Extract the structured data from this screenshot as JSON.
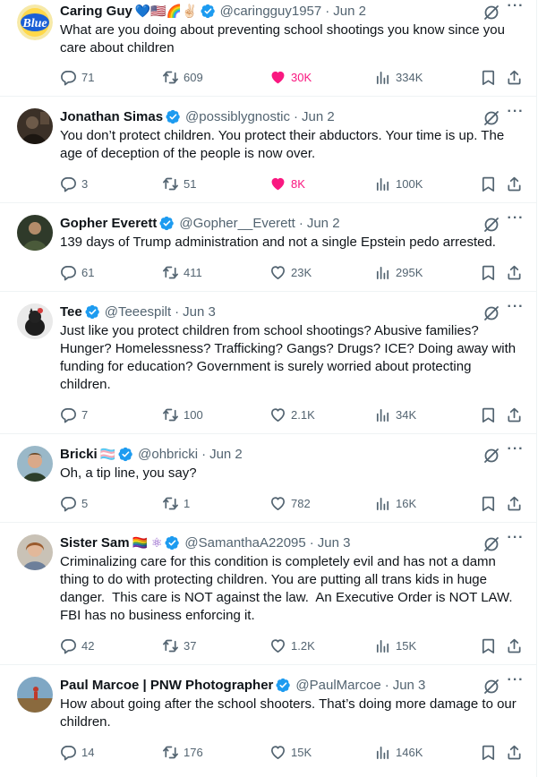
{
  "tweets": [
    {
      "name": "Caring Guy",
      "emoji": "💙🇺🇸🌈✌🏻",
      "handle": "@caringguy1957",
      "date": "Jun 2",
      "text": "What are you doing about preventing school shootings you know since you care about children",
      "replies": "71",
      "reposts": "609",
      "likes": "30K",
      "views": "334K",
      "liked": true
    },
    {
      "name": "Jonathan Simas",
      "emoji": "",
      "handle": "@possiblygnostic",
      "date": "Jun 2",
      "text": "You don’t protect children. You protect their abductors. Your time is up. The age of deception of the people is now over.",
      "replies": "3",
      "reposts": "51",
      "likes": "8K",
      "views": "100K",
      "liked": true
    },
    {
      "name": "Gopher Everett",
      "emoji": "",
      "handle": "@Gopher__Everett",
      "date": "Jun 2",
      "text": "139 days of Trump administration and not a single Epstein pedo arrested.",
      "replies": "61",
      "reposts": "411",
      "likes": "23K",
      "views": "295K",
      "liked": false
    },
    {
      "name": "Tee",
      "emoji": "",
      "handle": "@Teeespilt",
      "date": "Jun 3",
      "text": "Just like you protect children from school shootings? Abusive families? Hunger? Homelessness? Trafficking? Gangs? Drugs? ICE? Doing away with funding for education? Government is surely worried about protecting children.",
      "replies": "7",
      "reposts": "100",
      "likes": "2.1K",
      "views": "34K",
      "liked": false
    },
    {
      "name": "Bricki",
      "emoji": "🏳️‍⚧️",
      "handle": "@ohbricki",
      "date": "Jun 2",
      "text": "Oh, a tip line, you say?",
      "replies": "5",
      "reposts": "1",
      "likes": "782",
      "views": "16K",
      "liked": false
    },
    {
      "name": "Sister Sam",
      "emoji": "🏳️‍🌈 ⚛",
      "handle": "@SamanthaA22095",
      "date": "Jun 3",
      "text": "Criminalizing care for this condition is completely evil and has not a damn thing to do with protecting children. You are putting all trans kids in huge danger.  This care is NOT against the law.  An Executive Order is NOT LAW. FBI has no business enforcing it.",
      "replies": "42",
      "reposts": "37",
      "likes": "1.2K",
      "views": "15K",
      "liked": false
    },
    {
      "name": "Paul Marcoe | PNW Photographer",
      "emoji": "",
      "handle": "@PaulMarcoe",
      "date": "Jun 3",
      "text": "How about going after the school shooters. That’s doing more damage to our children.",
      "replies": "14",
      "reposts": "176",
      "likes": "15K",
      "views": "146K",
      "liked": false
    }
  ],
  "colors": {
    "verified": "#1d9bf0",
    "liked": "#f91880",
    "muted": "#536471"
  }
}
